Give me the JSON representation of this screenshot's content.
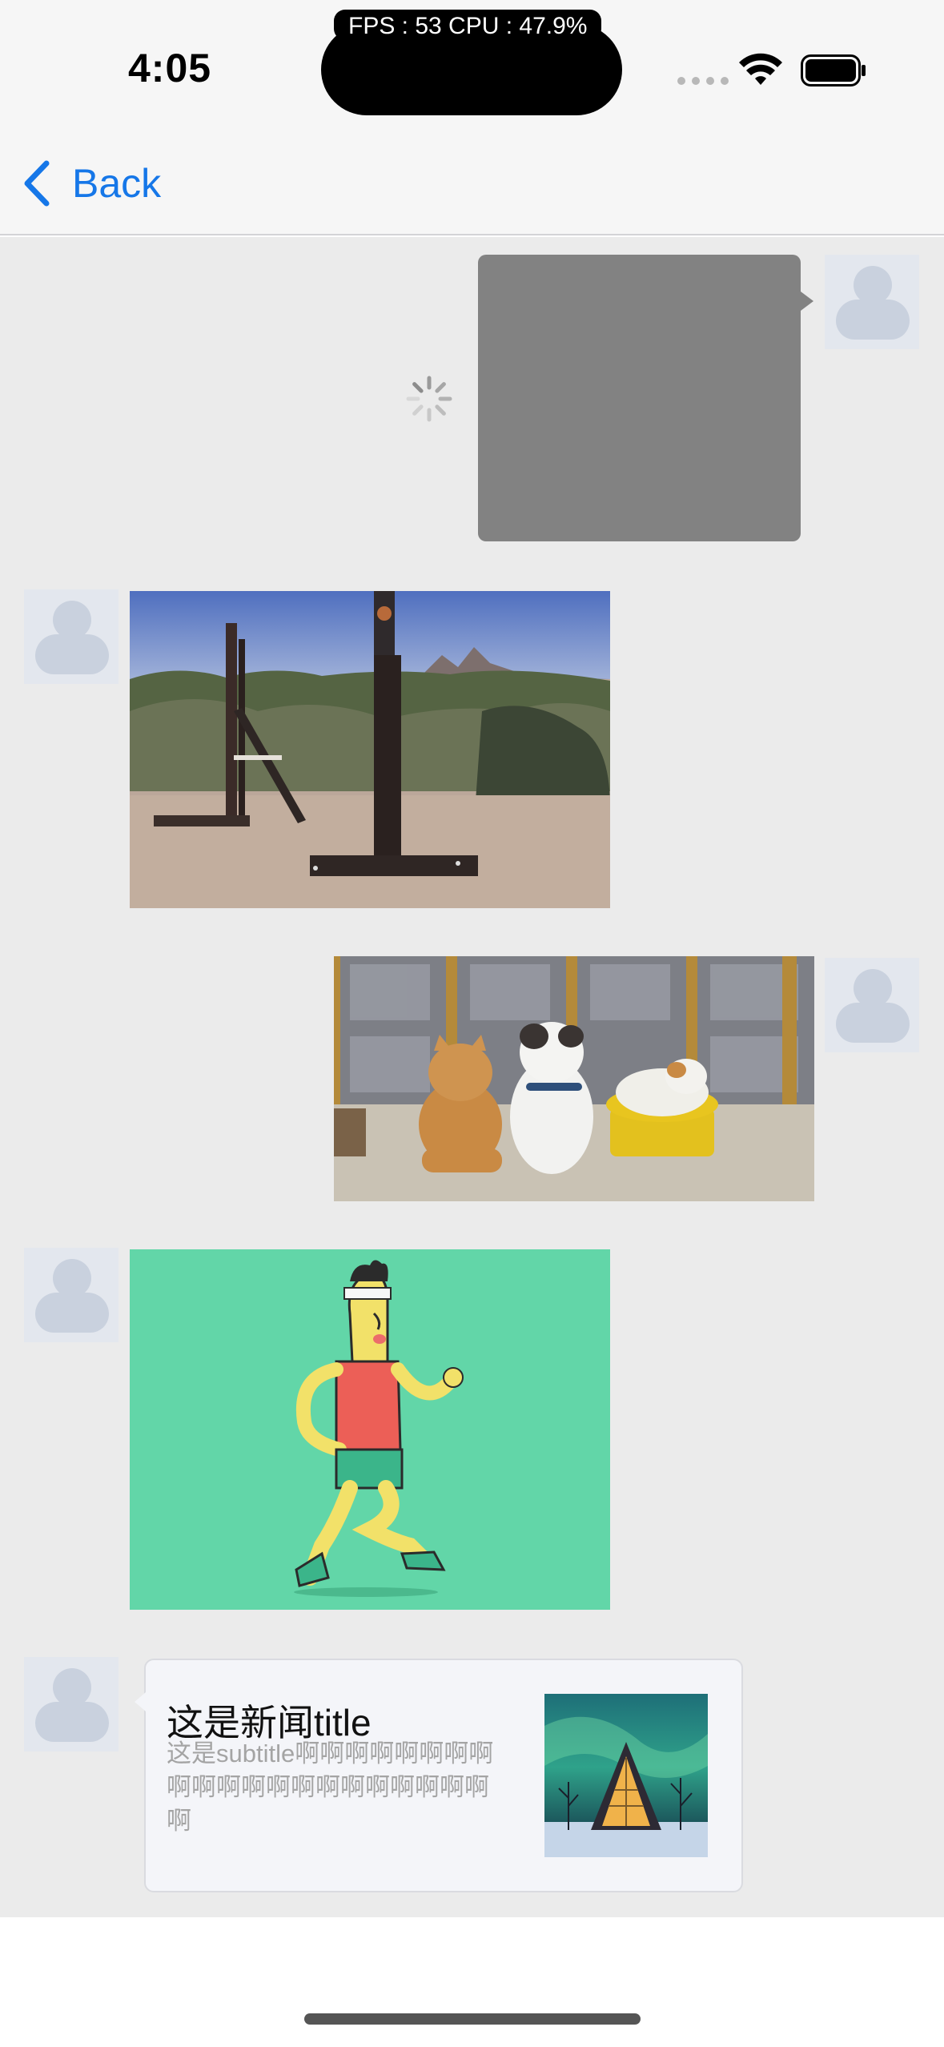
{
  "status_bar": {
    "time": "4:05",
    "fps_text": "FPS : 53 CPU : 47.9%",
    "wifi_icon": "wifi-icon",
    "battery_icon": "battery-icon"
  },
  "nav": {
    "back_label": "Back",
    "back_icon": "chevron-left-icon",
    "accent_color": "#1677e8"
  },
  "messages": [
    {
      "side": "right",
      "type": "image",
      "state": "loading",
      "content": "gray placeholder with spinner"
    },
    {
      "side": "left",
      "type": "image",
      "content": "desert test rig with post and launcher"
    },
    {
      "side": "right",
      "type": "image",
      "content": "three cats by a window"
    },
    {
      "side": "left",
      "type": "image",
      "content": "cartoon man running on green background"
    },
    {
      "side": "left",
      "type": "news",
      "title": "这是新闻title",
      "subtitle": "这是subtitle啊啊啊啊啊啊啊啊啊啊啊啊啊啊啊啊啊啊啊啊啊啊",
      "thumbnail": "aurora over lit A-frame cabin"
    }
  ],
  "colors": {
    "chat_background": "#ebebeb",
    "bar_background": "#f6f6f6",
    "news_card_background": "#f4f5f9",
    "running_bg": "#62d6a8"
  }
}
